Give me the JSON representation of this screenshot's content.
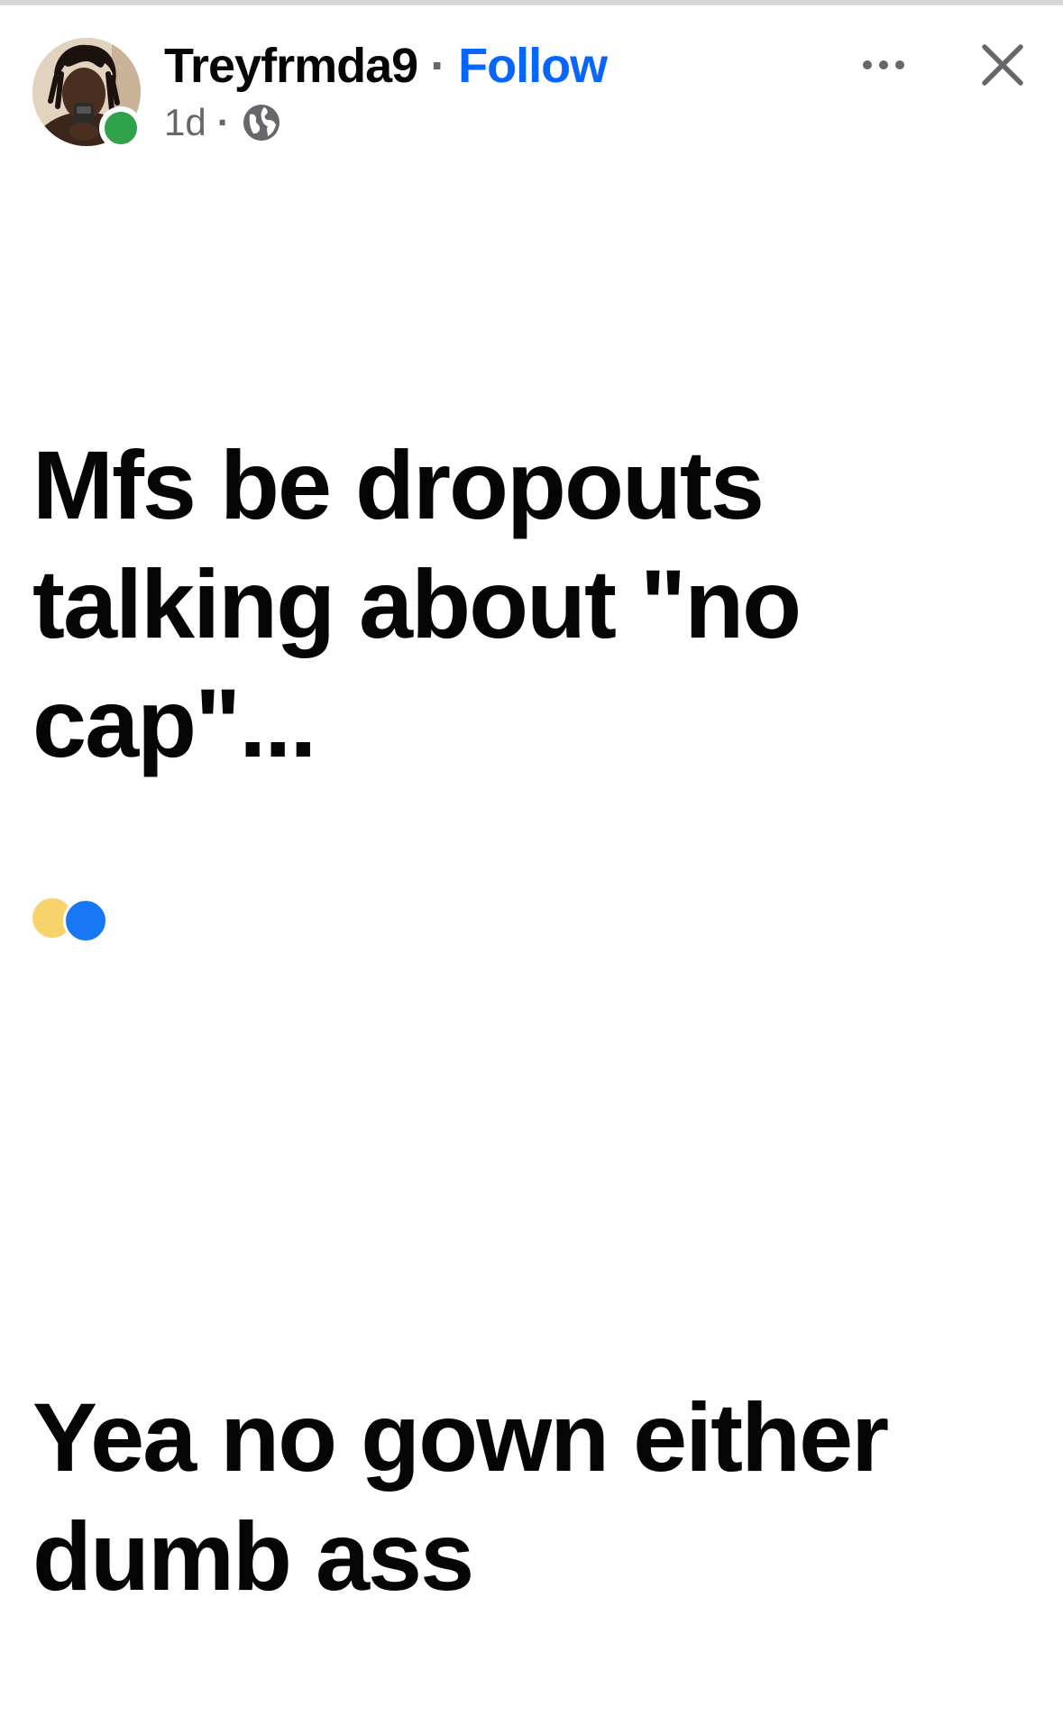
{
  "post": {
    "author": {
      "name": "Treyfrmda9",
      "follow_label": "Follow",
      "separator": "·",
      "online": true
    },
    "meta": {
      "time": "1d",
      "separator": "·",
      "audience_icon": "globe-icon"
    },
    "actions": {
      "more_icon": "more-icon",
      "close_icon": "close-icon"
    },
    "body": {
      "paragraph_1": "Mfs be dropouts talking about \"no cap\"...",
      "paragraph_2": "Yea no gown either dumb ass"
    },
    "reactions": {
      "icons": [
        "haha-reaction-icon",
        "like-reaction-icon"
      ]
    }
  },
  "colors": {
    "text": "#050505",
    "secondary": "#65676b",
    "link": "#0866ff",
    "online": "#31a24c",
    "divider": "#d4d5d9"
  }
}
